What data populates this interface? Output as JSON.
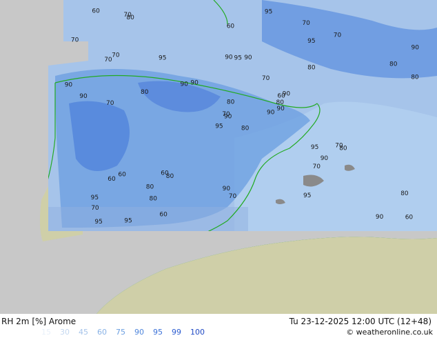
{
  "title": "RH 2m [%] Arome",
  "valid_time": "Tu 23-12-2025 12:00 UTC (12+48)",
  "credit": "© weatheronline.co.uk",
  "legend": [
    {
      "value": "15",
      "color": "#e8f0fa"
    },
    {
      "value": "30",
      "color": "#c4d8f0"
    },
    {
      "value": "45",
      "color": "#a6c4ea"
    },
    {
      "value": "60",
      "color": "#88b2e6"
    },
    {
      "value": "75",
      "color": "#6a9ee0"
    },
    {
      "value": "90",
      "color": "#4f86dc"
    },
    {
      "value": "95",
      "color": "#3a70d8"
    },
    {
      "value": "99",
      "color": "#2a5bd0"
    },
    {
      "value": "100",
      "color": "#1f49c4"
    }
  ],
  "colors": {
    "outside_domain": "#c8c8c8",
    "land_outside": "#cfcfa8",
    "coastline": "#22aa22",
    "contour_label": "#1a1a1a"
  },
  "map_labels": [
    "80",
    "70",
    "90",
    "95",
    "60",
    "80",
    "70",
    "90",
    "95",
    "90",
    "80",
    "60",
    "70",
    "90",
    "95",
    "80",
    "95",
    "90",
    "70",
    "60",
    "90",
    "70",
    "80",
    "95",
    "90",
    "80",
    "70",
    "60",
    "90",
    "95",
    "80",
    "70",
    "90",
    "80",
    "95",
    "70",
    "60",
    "90",
    "80",
    "70",
    "95",
    "90",
    "80",
    "70",
    "60",
    "90",
    "80",
    "95",
    "70",
    "90",
    "60",
    "80",
    "70",
    "90",
    "95",
    "80",
    "70",
    "60"
  ]
}
